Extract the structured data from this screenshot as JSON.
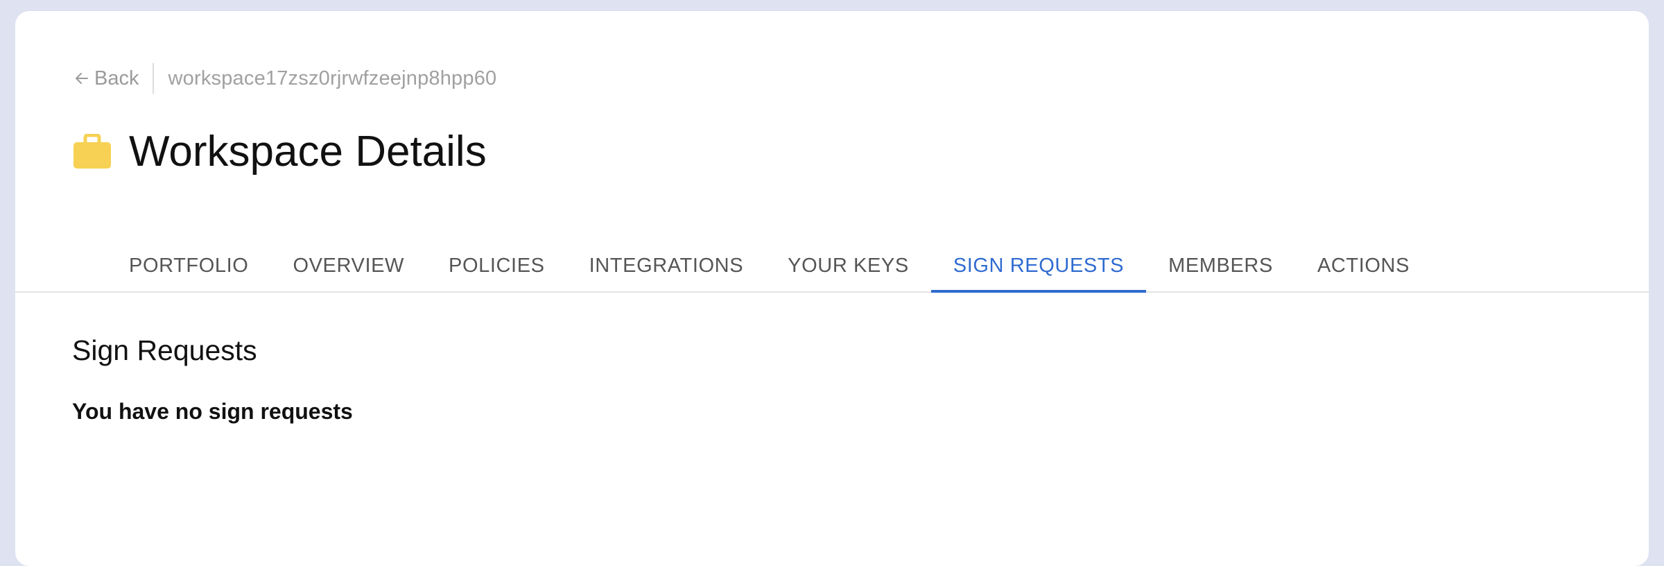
{
  "breadcrumb": {
    "back_label": "Back",
    "workspace_id": "workspace17zsz0rjrwfzeejnp8hpp60"
  },
  "header": {
    "title": "Workspace Details",
    "icon": "briefcase-icon",
    "icon_color": "#f7d154"
  },
  "tabs": [
    {
      "label": "PORTFOLIO"
    },
    {
      "label": "OVERVIEW"
    },
    {
      "label": "POLICIES"
    },
    {
      "label": "INTEGRATIONS"
    },
    {
      "label": "YOUR KEYS"
    },
    {
      "label": "SIGN REQUESTS",
      "active": true
    },
    {
      "label": "MEMBERS"
    },
    {
      "label": "ACTIONS"
    }
  ],
  "main": {
    "section_title": "Sign Requests",
    "empty_message": "You have no sign requests"
  },
  "colors": {
    "accent": "#2f6bd0",
    "page_background": "#dfe2f1"
  }
}
